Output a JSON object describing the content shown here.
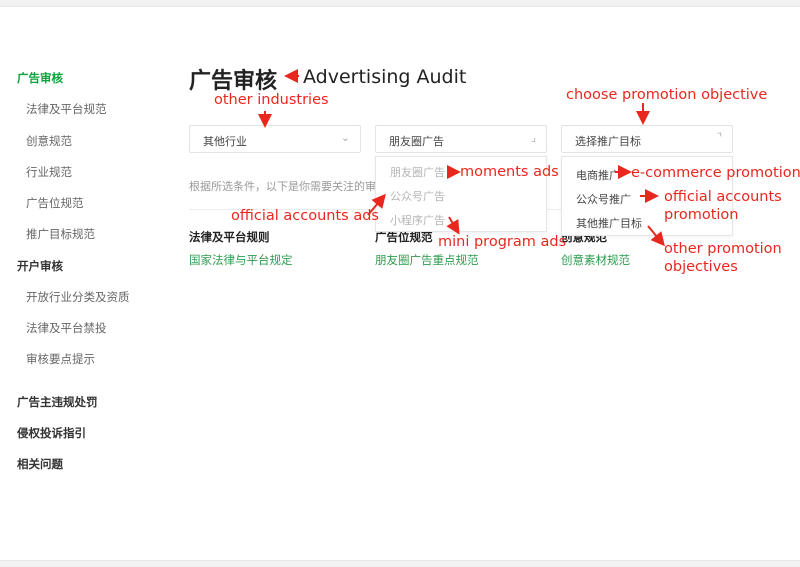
{
  "sidebar": {
    "groups": [
      {
        "label": "广告审核",
        "items": [
          "法律及平台规范",
          "创意规范",
          "行业规范",
          "广告位规范",
          "推广目标规范"
        ]
      },
      {
        "label": "开户审核",
        "items": [
          "开放行业分类及资质",
          "法律及平台禁投",
          "审核要点提示"
        ]
      },
      {
        "label": "广告主违规处罚"
      },
      {
        "label": "侵权投诉指引"
      },
      {
        "label": "相关问题"
      }
    ]
  },
  "main": {
    "title": "广告审核",
    "filters": {
      "industry": "其他行业",
      "ad_position": "朋友圈广告",
      "promotion_objective": "选择推广目标"
    },
    "hint": "根据所选条件，以下是你需要关注的审核规范",
    "columns": [
      {
        "title": "法律及平台规则",
        "link": "国家法律与平台规定"
      },
      {
        "title": "广告位规范",
        "link": "朋友圈广告重点规范"
      },
      {
        "title": "创意规范",
        "link": "创意素材规范"
      }
    ],
    "ad_position_options": [
      "朋友圈广告",
      "公众号广告",
      "小程序广告"
    ],
    "objective_options": [
      "电商推广",
      "公众号推广",
      "其他推广目标"
    ]
  },
  "annotations": {
    "title": "Advertising Audit",
    "industry": "other industries",
    "objective": "choose promotion objective",
    "moments": "moments ads",
    "official_ads": "official accounts ads",
    "mini_program": "mini program ads",
    "ecommerce": "e-commerce promotion",
    "official_promo_line1": "official accounts",
    "official_promo_line2": "promotion",
    "other_promo_line1": "other promotion",
    "other_promo_line2": "objectives"
  },
  "colors": {
    "accent": "#07a33b",
    "link": "#2e9b4e",
    "annotation": "#e8281e"
  }
}
